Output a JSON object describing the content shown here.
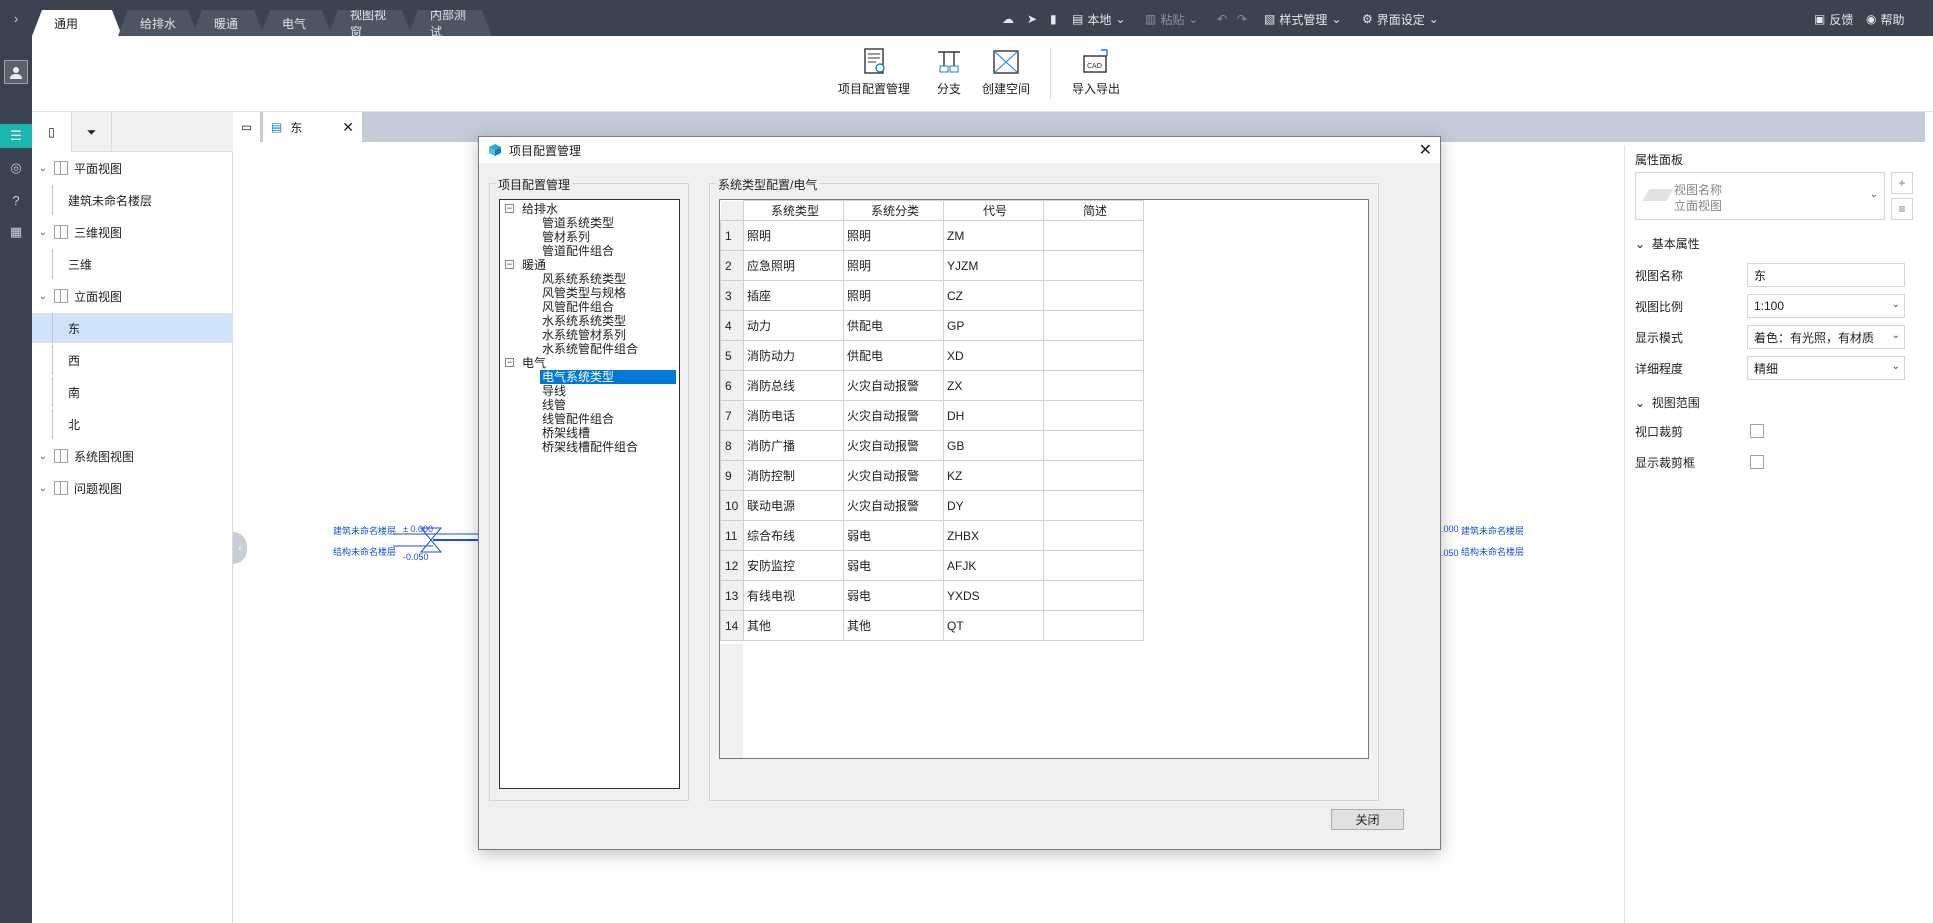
{
  "tabs": [
    {
      "label": "通用",
      "active": true
    },
    {
      "label": "给排水"
    },
    {
      "label": "暖通"
    },
    {
      "label": "电气"
    },
    {
      "label": "视图视窗"
    },
    {
      "label": "内部测试"
    }
  ],
  "toolbar": {
    "local": "本地",
    "paste": "粘贴",
    "style_manage": "样式管理",
    "ui_settings": "界面设定",
    "feedback": "反馈",
    "help": "帮助"
  },
  "ribbon": {
    "project_config": "项目配置管理",
    "branch": "分支",
    "create_space": "创建空间",
    "import_export": "导入导出"
  },
  "sidebar": {
    "nodes": [
      {
        "label": "平面视图",
        "level": 0,
        "has_icon": true
      },
      {
        "label": "建筑未命名楼层",
        "level": 1
      },
      {
        "label": "三维视图",
        "level": 0,
        "has_icon": true
      },
      {
        "label": "三维",
        "level": 1
      },
      {
        "label": "立面视图",
        "level": 0,
        "has_icon": true
      },
      {
        "label": "东",
        "level": 1,
        "selected": true
      },
      {
        "label": "西",
        "level": 1
      },
      {
        "label": "南",
        "level": 1
      },
      {
        "label": "北",
        "level": 1
      },
      {
        "label": "系统图视图",
        "level": 0,
        "has_icon": true
      },
      {
        "label": "问题视图",
        "level": 0,
        "has_icon": true
      }
    ]
  },
  "doc_tab": {
    "label": "东"
  },
  "canvas": {
    "left_label_1": "建筑未命名楼层",
    "left_value_1": "± 0.000",
    "left_label_2": "结构未命名楼层",
    "left_value_2": "-0.050",
    "right_value_1": ".000",
    "right_label_1": "建筑未命名楼层",
    "right_value_2": ".050",
    "right_label_2": "结构未命名楼层"
  },
  "props": {
    "title": "属性面板",
    "view_name_line1": "视图名称",
    "view_name_line2": "立面视图",
    "section_basic": "基本属性",
    "rows": [
      {
        "label": "视图名称",
        "value": "东"
      },
      {
        "label": "视图比例",
        "value": "1:100"
      },
      {
        "label": "显示模式",
        "value": "着色：有光照，有材质"
      },
      {
        "label": "详细程度",
        "value": "精细"
      }
    ],
    "section_range": "视图范围",
    "checks": [
      {
        "label": "视口裁剪"
      },
      {
        "label": "显示裁剪框"
      }
    ]
  },
  "dialog": {
    "title": "项目配置管理",
    "left_group": "项目配置管理",
    "right_group": "系统类型配置/电气",
    "close_label": "关闭",
    "tree": [
      {
        "label": "给排水",
        "level": 0
      },
      {
        "label": "管道系统类型",
        "level": 1
      },
      {
        "label": "管材系列",
        "level": 1
      },
      {
        "label": "管道配件组合",
        "level": 1
      },
      {
        "label": "暖通",
        "level": 0
      },
      {
        "label": "风系统系统类型",
        "level": 1
      },
      {
        "label": "风管类型与规格",
        "level": 1
      },
      {
        "label": "风管配件组合",
        "level": 1
      },
      {
        "label": "水系统系统类型",
        "level": 1
      },
      {
        "label": "水系统管材系列",
        "level": 1
      },
      {
        "label": "水系统管配件组合",
        "level": 1
      },
      {
        "label": "电气",
        "level": 0
      },
      {
        "label": "电气系统类型",
        "level": 1,
        "selected": true
      },
      {
        "label": "导线",
        "level": 1
      },
      {
        "label": "线管",
        "level": 1
      },
      {
        "label": "线管配件组合",
        "level": 1
      },
      {
        "label": "桥架线槽",
        "level": 1
      },
      {
        "label": "桥架线槽配件组合",
        "level": 1
      }
    ],
    "columns": [
      "系统类型",
      "系统分类",
      "代号",
      "简述"
    ],
    "rows": [
      {
        "n": "1",
        "type": "照明",
        "cls": "照明",
        "code": "ZM",
        "desc": ""
      },
      {
        "n": "2",
        "type": "应急照明",
        "cls": "照明",
        "code": "YJZM",
        "desc": ""
      },
      {
        "n": "3",
        "type": "插座",
        "cls": "照明",
        "code": "CZ",
        "desc": ""
      },
      {
        "n": "4",
        "type": "动力",
        "cls": "供配电",
        "code": "GP",
        "desc": ""
      },
      {
        "n": "5",
        "type": "消防动力",
        "cls": "供配电",
        "code": "XD",
        "desc": ""
      },
      {
        "n": "6",
        "type": "消防总线",
        "cls": "火灾自动报警",
        "code": "ZX",
        "desc": ""
      },
      {
        "n": "7",
        "type": "消防电话",
        "cls": "火灾自动报警",
        "code": "DH",
        "desc": ""
      },
      {
        "n": "8",
        "type": "消防广播",
        "cls": "火灾自动报警",
        "code": "GB",
        "desc": ""
      },
      {
        "n": "9",
        "type": "消防控制",
        "cls": "火灾自动报警",
        "code": "KZ",
        "desc": ""
      },
      {
        "n": "10",
        "type": "联动电源",
        "cls": "火灾自动报警",
        "code": "DY",
        "desc": ""
      },
      {
        "n": "11",
        "type": "综合布线",
        "cls": "弱电",
        "code": "ZHBX",
        "desc": ""
      },
      {
        "n": "12",
        "type": "安防监控",
        "cls": "弱电",
        "code": "AFJK",
        "desc": ""
      },
      {
        "n": "13",
        "type": "有线电视",
        "cls": "弱电",
        "code": "YXDS",
        "desc": ""
      },
      {
        "n": "14",
        "type": "其他",
        "cls": "其他",
        "code": "QT",
        "desc": ""
      }
    ]
  }
}
